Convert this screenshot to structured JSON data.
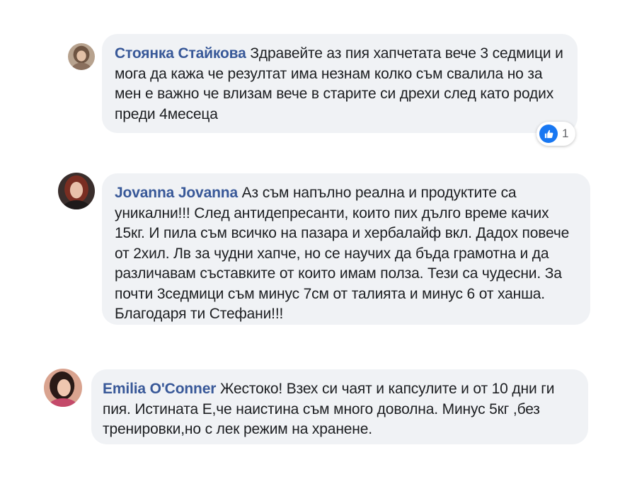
{
  "comments": [
    {
      "author": "Стоянка Стайкова",
      "text": "Здравейте аз пия хапчетата вече 3 седмици и мога да кажа че резултат има незнам колко съм свалила но за мен е важно че влизам вече в старите си дрехи след като родих преди 4месеца",
      "reaction": {
        "icon": "like-icon",
        "count": "1"
      }
    },
    {
      "author": "Jovanna Jovanna",
      "text": "Аз съм напълно реална и продуктите са уникални!!! След антидепресанти, които пих дълго време качих 15кг. И пила съм всичко на пазара и хербалайф вкл. Дадох повече от 2хил. Лв за чудни хапче, но се научих да бъда грамотна и да различавам съставките от които имам полза. Тези са чудесни. За почти 3седмици съм минус 7см от талията и минус 6 от ханша. Благодаря ти Стефани!!!"
    },
    {
      "author": "Emilia O'Conner",
      "text": "Жестоко! Взех си чаят и капсулите и от 10 дни ги пия. Истината Е,че наистина съм много доволна. Минус 5кг ,без тренировки,но с лек режим на хранене."
    }
  ],
  "colors": {
    "author": "#385898",
    "bubble": "#f0f2f5",
    "like": "#1877f2"
  }
}
